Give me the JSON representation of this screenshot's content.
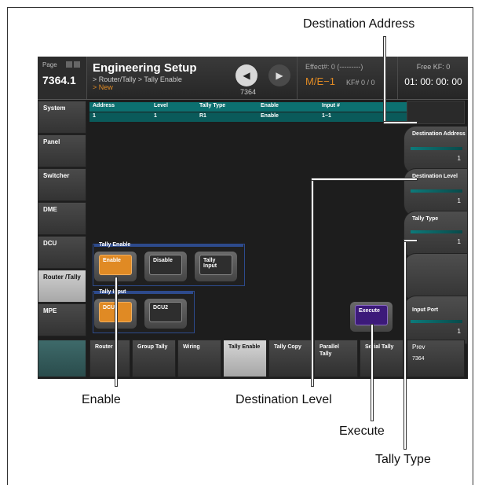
{
  "callouts": {
    "destination_address": "Destination Address",
    "enable": "Enable",
    "destination_level": "Destination Level",
    "execute": "Execute",
    "tally_type": "Tally Type"
  },
  "header": {
    "page_label": "Page",
    "page_number": "7364.1",
    "title": "Engineering Setup",
    "breadcrumb": "> Router/Tally > Tally Enable",
    "breadcrumb_new": "> New",
    "nav_prev_icon": "arrow-left",
    "nav_next_icon": "arrow-right",
    "nav_page": "7364",
    "effect": "Effect#: 0 (---------)",
    "me": "M/E−1",
    "kf": "KF# 0 / 0",
    "free_kf": "Free KF: 0",
    "timecode": "01: 00: 00: 00"
  },
  "left_tabs": [
    {
      "label": "System"
    },
    {
      "label": "Panel"
    },
    {
      "label": "Switcher"
    },
    {
      "label": "DME"
    },
    {
      "label": "DCU"
    },
    {
      "label": "Router /Tally"
    },
    {
      "label": "MPE"
    }
  ],
  "table": {
    "columns": [
      "Address",
      "Level",
      "Tally Type",
      "Enable",
      "Input #"
    ],
    "rows": [
      [
        "1",
        "1",
        "R1",
        "Enable",
        "1−1"
      ]
    ]
  },
  "tally_enable": {
    "group_label": "Tally Enable",
    "enable": "Enable",
    "disable": "Disable",
    "tally_input": "Tally Input"
  },
  "tally_input": {
    "group_label": "Tally Input",
    "dcu": "DCU",
    "dcu2": "DCU2"
  },
  "execute": "Execute",
  "right_params": [
    {
      "label": "Destination Address",
      "value": "1"
    },
    {
      "label": "Destination Level",
      "value": "1"
    },
    {
      "label": "Tally Type",
      "value": "1"
    },
    {
      "label": "",
      "value": ""
    },
    {
      "label": "Input Port",
      "value": "1"
    }
  ],
  "bottom_tabs": [
    {
      "label": "Router"
    },
    {
      "label": "Group Tally"
    },
    {
      "label": "Wiring"
    },
    {
      "label": "Tally Enable"
    },
    {
      "label": "Tally Copy"
    },
    {
      "label": "Parallel Tally"
    },
    {
      "label": "Serial Tally"
    }
  ],
  "prev": {
    "label": "Prev",
    "page": "7364"
  },
  "colors": {
    "accent": "#e08a24",
    "teal": "#0c7070",
    "purple": "#3c1a7a",
    "group_border": "#2d4a8c"
  }
}
